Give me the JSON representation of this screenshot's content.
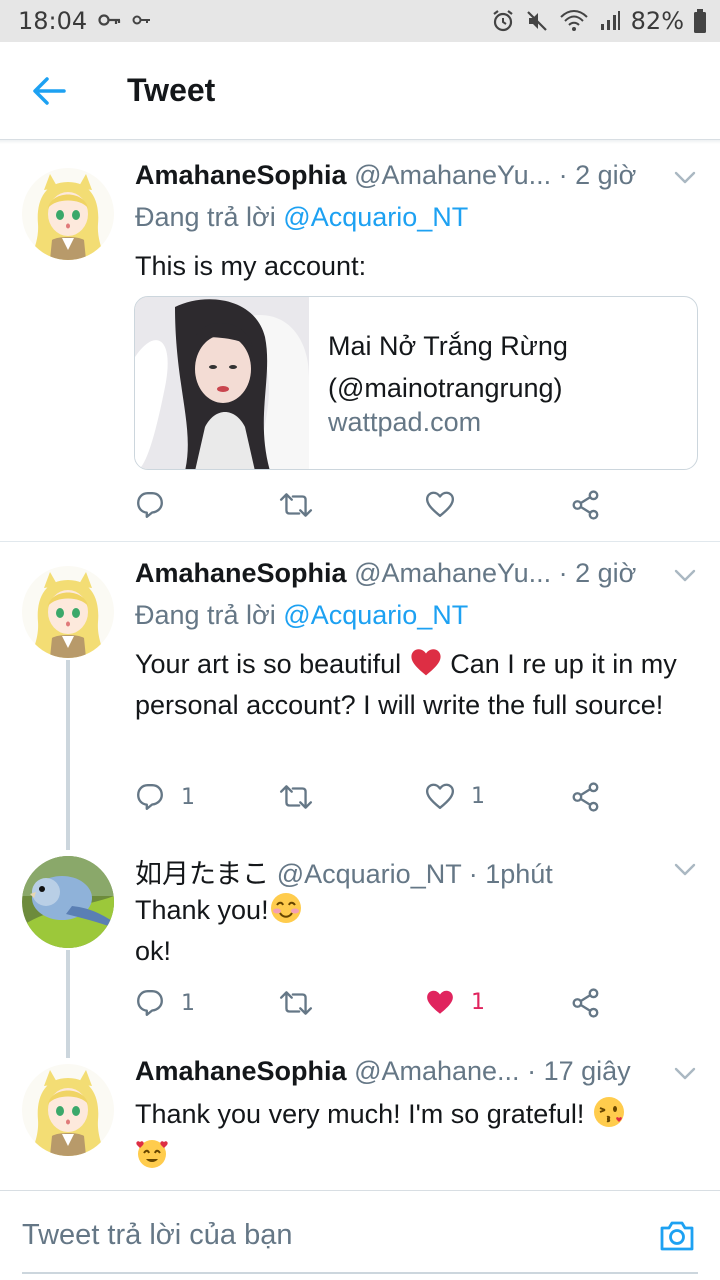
{
  "status_bar": {
    "time": "18:04",
    "battery": "82%"
  },
  "header": {
    "title": "Tweet"
  },
  "tweets": [
    {
      "name": "AmahaneSophia",
      "handle": "@AmahaneYu...",
      "time": "· 2 giờ",
      "reply_prefix": "Đang trả lời",
      "reply_mention": "@Acquario_NT",
      "text": "This is my account:",
      "card": {
        "title_line1": "Mai Nở Trắng Rừng",
        "title_line2": "(@mainotrangrung)",
        "domain": "wattpad.com"
      },
      "reply_count": "",
      "like_count": ""
    },
    {
      "name": "AmahaneSophia",
      "handle": "@AmahaneYu...",
      "time": "· 2 giờ",
      "reply_prefix": "Đang trả lời",
      "reply_mention": "@Acquario_NT",
      "text_part1": "Your art is so beautiful",
      "text_part2": " Can I re up it in my personal account? I will write the full source!",
      "reply_count": "1",
      "like_count": "1"
    },
    {
      "name": "如月たまこ",
      "handle": "@Acquario_NT",
      "time": "· 1phút",
      "text_line1": "Thank you!",
      "text_line2": "ok!",
      "reply_count": "1",
      "like_count": "1",
      "liked": true
    },
    {
      "name": "AmahaneSophia",
      "handle": "@Amahane...",
      "time": "· 17 giây",
      "text": "Thank you very much! I'm so grateful!"
    }
  ],
  "reply_bar": {
    "placeholder": "Tweet trả lời của bạn"
  },
  "colors": {
    "accent": "#1da1f2",
    "like": "#e0245e",
    "muted": "#657786"
  }
}
